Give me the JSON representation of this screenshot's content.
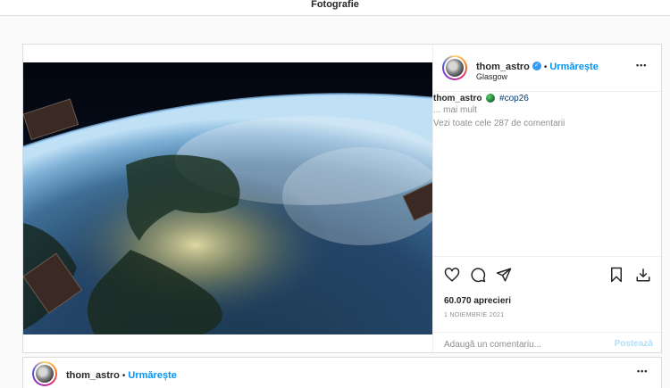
{
  "header": {
    "title": "Fotografie"
  },
  "post": {
    "username": "thom_astro",
    "verified": true,
    "separator": "•",
    "follow_label": "Urmărește",
    "location": "Glasgow",
    "more_label": "•••",
    "caption_user": "thom_astro",
    "caption_hashtag": "#cop26",
    "more_text": "... mai mult",
    "view_comments": "Vezi toate cele 287 de comentarii",
    "likes": "60.070 aprecieri",
    "date": "1 NOIEMBRIE 2021",
    "comment_placeholder": "Adaugă un comentariu...",
    "post_button": "Postează",
    "icons": [
      "heart-icon",
      "comment-icon",
      "share-icon",
      "bookmark-icon",
      "download-icon"
    ],
    "accent": "#0095f6"
  },
  "next_post": {
    "username": "thom_astro",
    "separator": "•",
    "follow_label": "Urmărește",
    "more_label": "•••"
  }
}
